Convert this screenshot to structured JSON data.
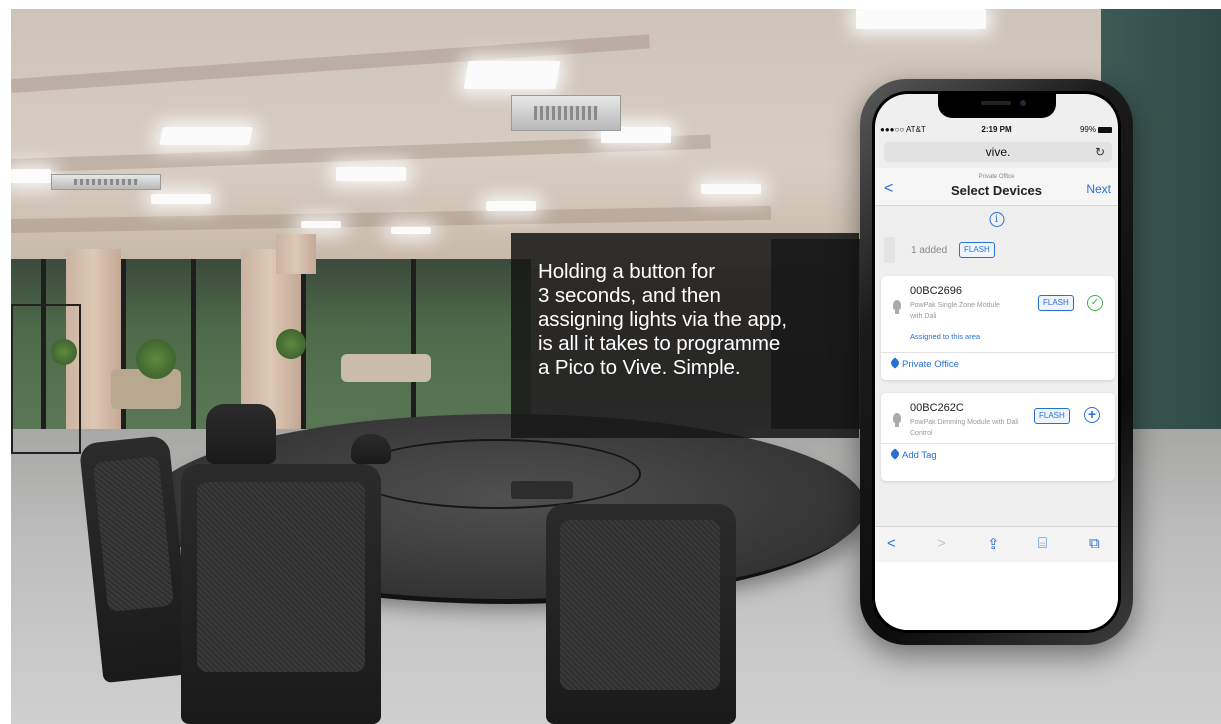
{
  "caption": {
    "line1": "Holding a button for",
    "line2": "3 seconds, and then",
    "line3": "assigning lights via the app,",
    "line4": "is all it takes to programme",
    "line5": "a Pico to Vive. Simple."
  },
  "phone": {
    "status": {
      "carrier": "●●●○○ AT&T",
      "time": "2:19 PM",
      "battery": "99%"
    },
    "url": "vive.",
    "nav": {
      "back": "<",
      "subtitle": "Private Office",
      "title": "Select Devices",
      "next": "Next"
    },
    "added": {
      "text": "1 added",
      "flash": "FLASH"
    },
    "devices": [
      {
        "id": "00BC2696",
        "desc": "PowPak Single Zone Module with Dali",
        "assigned": "Assigned to this area",
        "flash": "FLASH",
        "tag": "Private Office",
        "status_icon": "check-circle-icon"
      },
      {
        "id": "00BC262C",
        "desc": "PowPak Dimming Module with Dali Control",
        "flash": "FLASH",
        "tag": "Add Tag",
        "status_icon": "plus-circle-icon"
      }
    ],
    "toolbar": {
      "back": "<",
      "forward": ">",
      "share": "⇪",
      "bookmarks": "⌸",
      "tabs": "⧉"
    }
  },
  "colors": {
    "accent": "#2a6fd6",
    "success": "#3cb44a",
    "caption_bg": "#161616"
  }
}
